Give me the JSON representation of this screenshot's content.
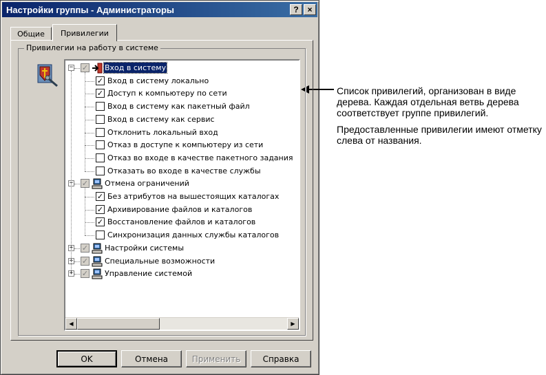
{
  "window": {
    "title": "Настройки группы - Администраторы",
    "help_btn": "?",
    "close_btn": "×"
  },
  "tabs": [
    {
      "label": "Общие",
      "active": false
    },
    {
      "label": "Привилегии",
      "active": true
    }
  ],
  "group": {
    "label": "Привилегии на работу в системе"
  },
  "tree": [
    {
      "label": "Вход в систему",
      "level": 0,
      "expanded": true,
      "checked": "partial",
      "icon": "login-arrow-icon",
      "selected": true
    },
    {
      "label": "Вход в систему локально",
      "level": 1,
      "checked": true
    },
    {
      "label": "Доступ к компьютеру по сети",
      "level": 1,
      "checked": true
    },
    {
      "label": "Вход в систему как пакетный файл",
      "level": 1,
      "checked": false
    },
    {
      "label": "Вход в систему как сервис",
      "level": 1,
      "checked": false
    },
    {
      "label": "Отклонить локальный вход",
      "level": 1,
      "checked": false
    },
    {
      "label": "Отказ в доступе к компьютеру из сети",
      "level": 1,
      "checked": false
    },
    {
      "label": "Отказ во входе в качестве пакетного задания",
      "level": 1,
      "checked": false
    },
    {
      "label": "Отказать во входе в качестве службы",
      "level": 1,
      "checked": false
    },
    {
      "label": "Отмена ограничений",
      "level": 0,
      "expanded": true,
      "checked": "partial",
      "icon": "computer-icon"
    },
    {
      "label": "Без атрибутов на вышестоящих каталогах",
      "level": 1,
      "checked": true
    },
    {
      "label": "Архивирование файлов и каталогов",
      "level": 1,
      "checked": true
    },
    {
      "label": "Восстановление файлов и каталогов",
      "level": 1,
      "checked": true
    },
    {
      "label": "Синхронизация данных службы каталогов",
      "level": 1,
      "checked": false
    },
    {
      "label": "Настройки системы",
      "level": 0,
      "expanded": false,
      "checked": "partial",
      "icon": "computer-icon"
    },
    {
      "label": "Специальные возможности",
      "level": 0,
      "expanded": false,
      "checked": "partial",
      "icon": "computer-icon"
    },
    {
      "label": "Управление системой",
      "level": 0,
      "expanded": false,
      "checked": "partial",
      "icon": "computer-icon"
    }
  ],
  "buttons": {
    "ok": "OK",
    "cancel": "Отмена",
    "apply": "Применить",
    "help": "Справка"
  },
  "annotation": {
    "p1": "Список привилегий, организован в виде дерева. Каждая отдельная ветвь дерева соответствует группе привилегий.",
    "p2": "Предоставленные привилегии имеют отметку слева от названия."
  },
  "colors": {
    "titlebar": "#0a246a",
    "face": "#d4d0c8",
    "selection": "#0a246a"
  }
}
